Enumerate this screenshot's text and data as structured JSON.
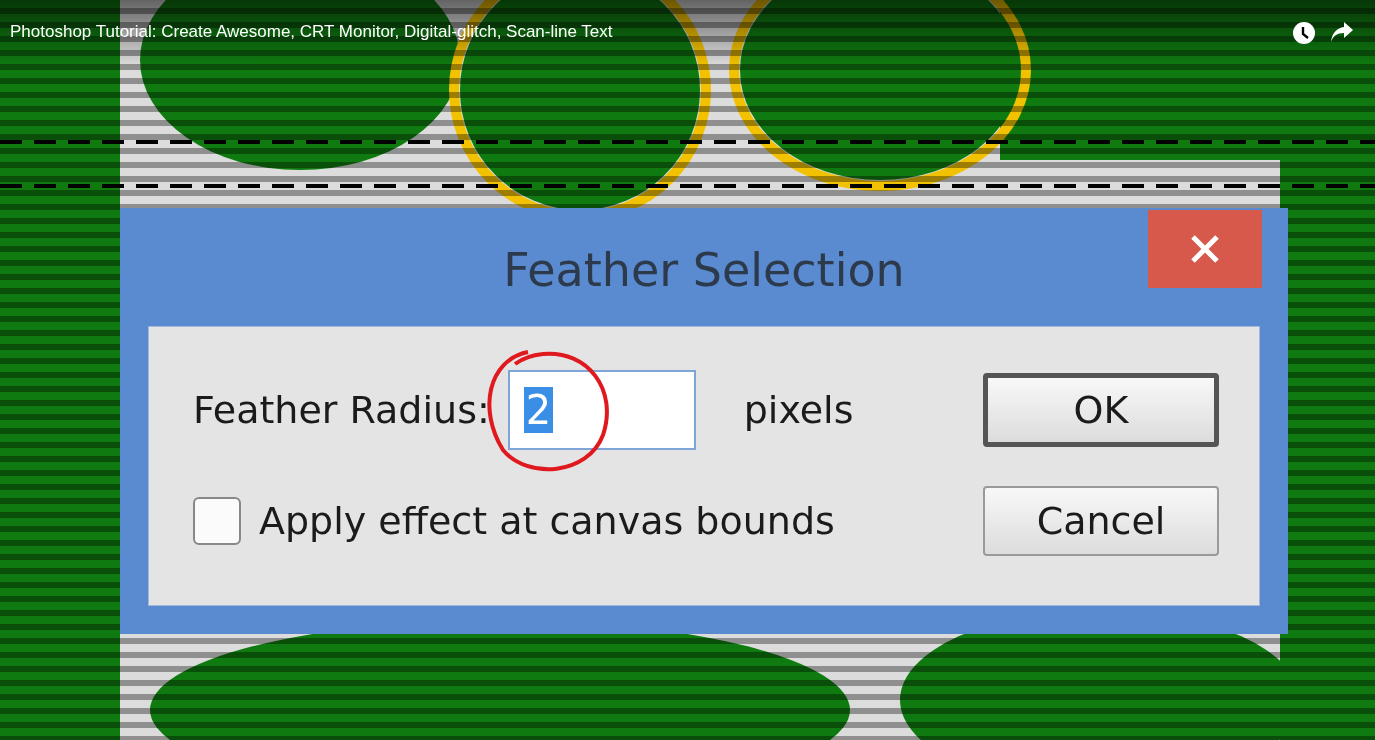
{
  "video": {
    "title": "Photoshop Tutorial: Create Awesome, CRT Monitor, Digital-glitch, Scan-line Text"
  },
  "dialog": {
    "title": "Feather Selection",
    "radius": {
      "label": "Feather Radius:",
      "value": "2",
      "selected": true,
      "unit": "pixels",
      "circled": true
    },
    "checkbox": {
      "label": "Apply effect at canvas bounds",
      "checked": false
    },
    "buttons": [
      {
        "label": "OK",
        "default": true
      },
      {
        "label": "Cancel",
        "default": false
      }
    ]
  }
}
